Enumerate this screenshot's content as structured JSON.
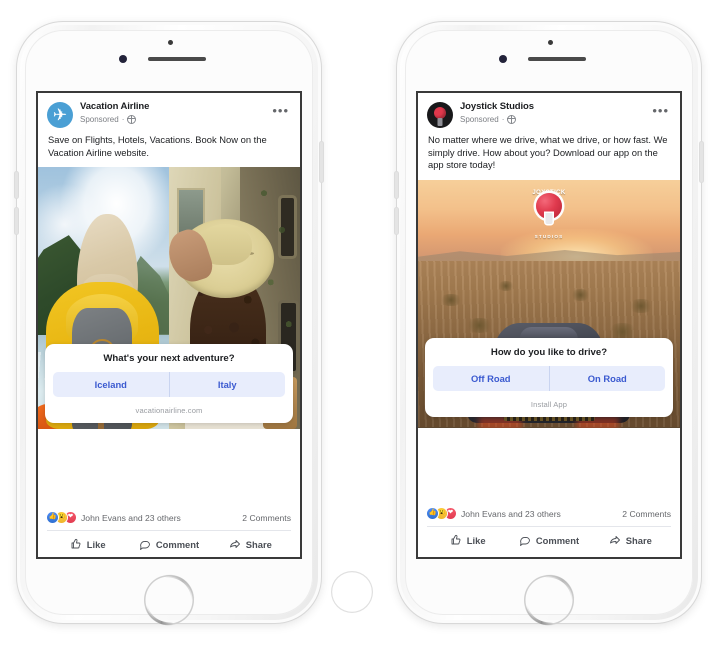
{
  "scene": {
    "description": "Two white iPhones side by side showing Facebook poll ad mockups",
    "device_count": 2
  },
  "phones": [
    {
      "id": "left",
      "post": {
        "page_name": "Vacation Airline",
        "sponsored_label": "Sponsored",
        "audience_icon": "globe-icon",
        "menu_icon": "more-options-icon",
        "avatar_icon": "airplane-icon",
        "body_text": "Save on Flights, Hotels, Vacations. Book Now on the Vacation Airline website.",
        "media": {
          "type": "split-photo",
          "left_scene": "fjord with blonde woman in yellow jacket and grey backpack",
          "right_scene": "italian alley with woman in straw hat and red polka dot dress"
        },
        "poll": {
          "question": "What's your next adventure?",
          "options": [
            "Iceland",
            "Italy"
          ],
          "cta": "vacationairline.com"
        },
        "engagement": {
          "reactions": [
            "like",
            "wow",
            "love"
          ],
          "names": "John Evans and 23 others",
          "comments": "2 Comments",
          "actions": [
            {
              "label": "Like",
              "icon": "thumbs-up-icon"
            },
            {
              "label": "Comment",
              "icon": "comment-bubble-icon"
            },
            {
              "label": "Share",
              "icon": "share-arrow-icon"
            }
          ]
        }
      }
    },
    {
      "id": "right",
      "post": {
        "page_name": "Joystick Studios",
        "sponsored_label": "Sponsored",
        "audience_icon": "globe-icon",
        "menu_icon": "more-options-icon",
        "avatar_icon": "joystick-icon",
        "body_text": "No matter where we drive, what we drive, or how fast. We simply drive. How about you? Download our app on the app store today!",
        "media": {
          "type": "photo",
          "scene": "dark sports car driving on desert road at sunset",
          "badge_top": "JOYSTICK",
          "badge_bottom": "STUDIOS"
        },
        "poll": {
          "question": "How do you like to drive?",
          "options": [
            "Off Road",
            "On Road"
          ],
          "cta": "Install App"
        },
        "engagement": {
          "reactions": [
            "like",
            "wow",
            "love"
          ],
          "names": "John Evans and 23 others",
          "comments": "2 Comments",
          "actions": [
            {
              "label": "Like",
              "icon": "thumbs-up-icon"
            },
            {
              "label": "Comment",
              "icon": "comment-bubble-icon"
            },
            {
              "label": "Share",
              "icon": "share-arrow-icon"
            }
          ]
        }
      }
    }
  ],
  "colors": {
    "poll_option_bg": "#e8edfc",
    "poll_option_text": "#3b5ad0",
    "text_primary": "#1c1e21",
    "text_secondary": "#65676b",
    "avatar_airline_bg": "#4a9fd4",
    "avatar_joystick_bg": "#18181a",
    "joystick_red": "#e0384c"
  }
}
